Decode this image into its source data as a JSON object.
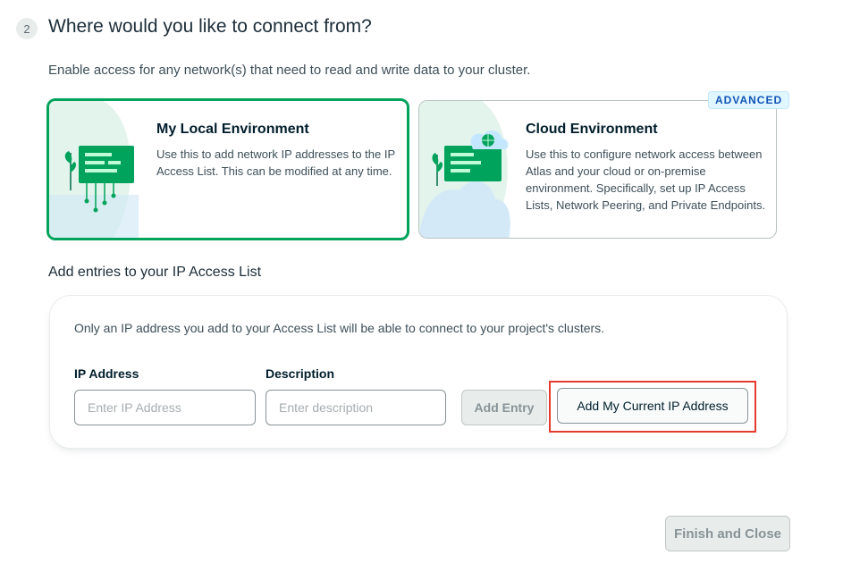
{
  "step": {
    "number": "2",
    "title": "Where would you like to connect from?",
    "subtitle": "Enable access for any network(s) that need to read and write data to your cluster."
  },
  "environments": [
    {
      "title": "My Local Environment",
      "description": "Use this to add network IP addresses to the IP Access List. This can be modified at any time.",
      "selected": true,
      "illustration": "local-network-icon"
    },
    {
      "title": "Cloud Environment",
      "description": "Use this to configure network access between Atlas and your cloud or on-premise environment. Specifically, set up IP Access Lists, Network Peering, and Private Endpoints.",
      "badge": "ADVANCED",
      "selected": false,
      "illustration": "cloud-network-icon"
    }
  ],
  "access_list": {
    "section_title": "Add entries to your IP Access List",
    "note": "Only an IP address you add to your Access List will be able to connect to your project's clusters.",
    "ip_label": "IP Address",
    "ip_placeholder": "Enter IP Address",
    "ip_value": "",
    "description_label": "Description",
    "description_placeholder": "Enter description",
    "description_value": "",
    "add_entry_label": "Add Entry",
    "add_current_ip_label": "Add My Current IP Address"
  },
  "footer": {
    "finish_label": "Finish and Close"
  },
  "colors": {
    "selected_border": "#00a35c",
    "badge_text": "#1254b7",
    "highlight": "#e33b2e"
  }
}
